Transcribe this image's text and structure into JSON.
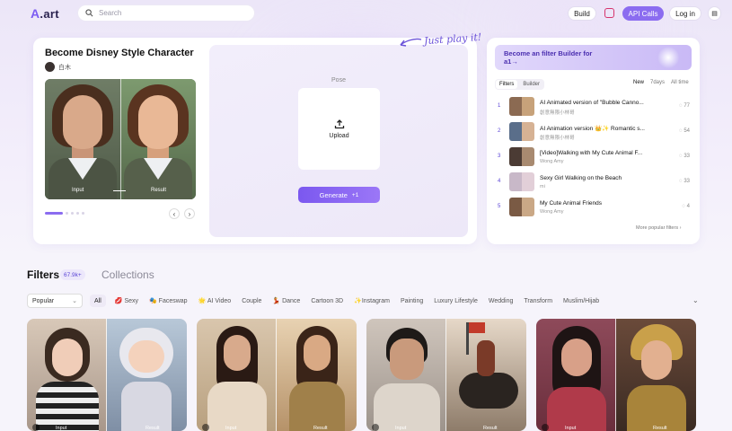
{
  "header": {
    "logo": ".art",
    "search_placeholder": "Search",
    "build": "Build",
    "api_calls": "API Calls",
    "login": "Log in"
  },
  "colors": {
    "accent": "#7c5cf2",
    "accent_light": "#ece7fb"
  },
  "feature": {
    "title": "Become Disney Style Character",
    "author": "白木",
    "input_label": "Input",
    "result_label": "Result",
    "pose_label": "Pose",
    "upload_label": "Upload",
    "generate_label": "Generate",
    "generate_cost": "+1",
    "tagline": "Just play it!"
  },
  "sidebar": {
    "promo": "Become an filter Builder for a1→",
    "tabs": [
      "Filters",
      "Builder"
    ],
    "timeframes": [
      "New",
      "7days",
      "All time"
    ],
    "rows": [
      {
        "rank": "1",
        "name": "AI Animated version of \"Bubble Canno...",
        "author": "創意無限小林哥",
        "count": "77"
      },
      {
        "rank": "2",
        "name": "AI Animation version 👑✨ Romantic s...",
        "author": "創意無限小林哥",
        "count": "54"
      },
      {
        "rank": "3",
        "name": "[Video]Walking with My Cute Animal F...",
        "author": "Wong Amy",
        "count": "33"
      },
      {
        "rank": "4",
        "name": "Sexy Girl Walking on the Beach",
        "author": "mi",
        "count": "33"
      },
      {
        "rank": "5",
        "name": "My Cute Animal Friends",
        "author": "Wong Amy",
        "count": "4"
      }
    ],
    "more": "More popular filters ›"
  },
  "filters": {
    "title": "Filters",
    "count": "67.9k+",
    "collections": "Collections",
    "sort": "Popular",
    "tags": [
      "All",
      "💋 Sexy",
      "🎭 Faceswap",
      "🌟 AI Video",
      "Couple",
      "💃 Dance",
      "Cartoon 3D",
      "✨Instagram",
      "Painting",
      "Luxury Lifestyle",
      "Wedding",
      "Transform",
      "Muslim/Hijab"
    ]
  },
  "gallery": [
    {
      "input": "Input",
      "result": "Result"
    },
    {
      "input": "Input",
      "result": "Result"
    },
    {
      "input": "Input",
      "result": "Result"
    },
    {
      "input": "Input",
      "result": "Result"
    }
  ]
}
